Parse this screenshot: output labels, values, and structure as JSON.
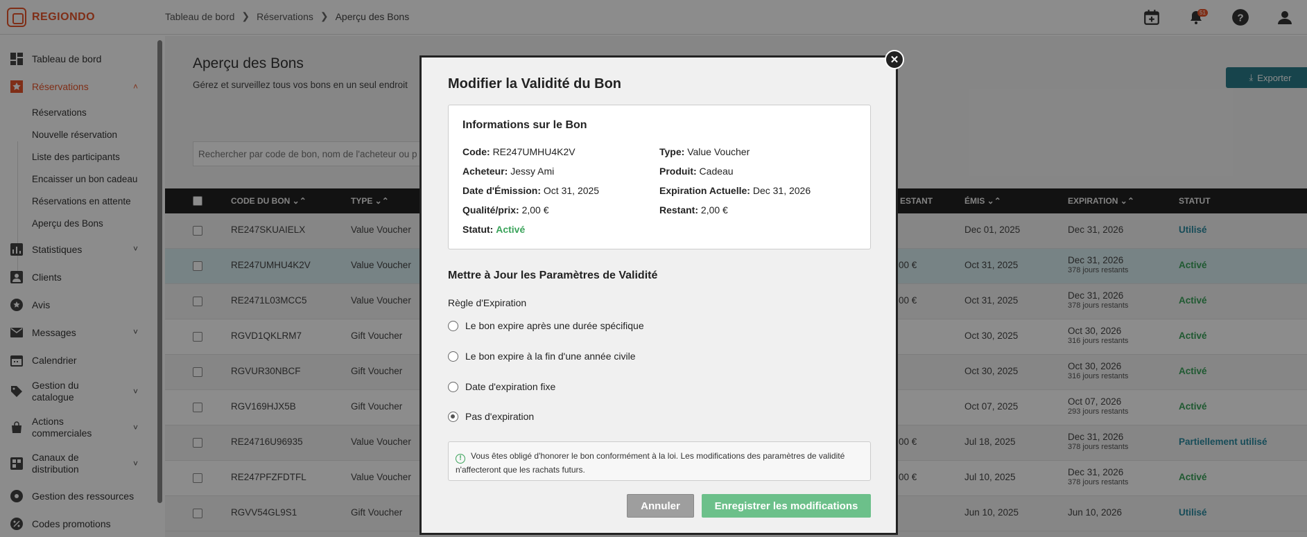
{
  "brand": {
    "name": "REGIONDO",
    "accent": "#e8552a"
  },
  "breadcrumb": [
    "Tableau de bord",
    "Réservations",
    "Aperçu des Bons"
  ],
  "topbar": {
    "notifications_count": "51"
  },
  "sidebar": {
    "items": [
      {
        "label": "Tableau de bord",
        "icon": "dashboard-icon"
      },
      {
        "label": "Réservations",
        "icon": "star-icon"
      },
      {
        "label": "Statistiques",
        "icon": "bar-chart-icon"
      },
      {
        "label": "Clients",
        "icon": "person-icon"
      },
      {
        "label": "Avis",
        "icon": "star-circle-icon"
      },
      {
        "label": "Messages",
        "icon": "mail-icon"
      },
      {
        "label": "Calendrier",
        "icon": "calendar-icon"
      },
      {
        "label": "Gestion du catalogue",
        "icon": "tag-icon"
      },
      {
        "label": "Actions commerciales",
        "icon": "shopping-bag-icon"
      },
      {
        "label": "Canaux de distribution",
        "icon": "grid-icon"
      },
      {
        "label": "Gestion des ressources",
        "icon": "resource-icon"
      },
      {
        "label": "Codes promotions",
        "icon": "percent-icon"
      }
    ],
    "sub_items": [
      "Réservations",
      "Nouvelle réservation",
      "Liste des participants",
      "Encaisser un bon cadeau",
      "Réservations en attente",
      "Aperçu des Bons"
    ]
  },
  "page": {
    "title": "Aperçu des Bons",
    "subtitle": "Gérez et surveillez tous vos bons en un seul endroit",
    "export_label": "Exporter",
    "search_placeholder": "Rechercher par code de bon, nom de l'acheteur ou p"
  },
  "table": {
    "headers": {
      "code": "CODE DU BON",
      "type": "TYPE",
      "restant": "ESTANT",
      "emis": "ÉMIS",
      "expiration": "EXPIRATION",
      "statut": "STATUT"
    },
    "rows": [
      {
        "code": "RE247SKUAIELX",
        "type": "Value Voucher",
        "restant": "",
        "emis": "Dec 01, 2025",
        "exp": "Dec 31, 2026",
        "exp_sub": "",
        "statut": "Utilisé"
      },
      {
        "code": "RE247UMHU4K2V",
        "type": "Value Voucher",
        "restant": "00 €",
        "emis": "Oct 31, 2025",
        "exp": "Dec 31, 2026",
        "exp_sub": "378 jours restants",
        "statut": "Activé"
      },
      {
        "code": "RE2471L03MCC5",
        "type": "Value Voucher",
        "restant": "00 €",
        "emis": "Oct 31, 2025",
        "exp": "Dec 31, 2026",
        "exp_sub": "378 jours restants",
        "statut": "Activé"
      },
      {
        "code": "RGVD1QKLRM7",
        "type": "Gift Voucher",
        "restant": "",
        "emis": "Oct 30, 2025",
        "exp": "Oct 30, 2026",
        "exp_sub": "316 jours restants",
        "statut": "Activé"
      },
      {
        "code": "RGVUR30NBCF",
        "type": "Gift Voucher",
        "restant": "",
        "emis": "Oct 30, 2025",
        "exp": "Oct 30, 2026",
        "exp_sub": "316 jours restants",
        "statut": "Activé"
      },
      {
        "code": "RGV169HJX5B",
        "type": "Gift Voucher",
        "restant": "",
        "emis": "Oct 07, 2025",
        "exp": "Oct 07, 2026",
        "exp_sub": "293 jours restants",
        "statut": "Activé"
      },
      {
        "code": "RE24716U96935",
        "type": "Value Voucher",
        "restant": "00 €",
        "emis": "Jul 18, 2025",
        "exp": "Dec 31, 2026",
        "exp_sub": "378 jours restants",
        "statut": "Partiellement utilisé"
      },
      {
        "code": "RE247PFZFDTFL",
        "type": "Value Voucher",
        "restant": "00 €",
        "emis": "Jul 10, 2025",
        "exp": "Dec 31, 2026",
        "exp_sub": "378 jours restants",
        "statut": "Activé"
      },
      {
        "code": "RGVV54GL9S1",
        "type": "Gift Voucher",
        "restant": "",
        "emis": "Jun 10, 2025",
        "exp": "Jun 10, 2026",
        "exp_sub": "",
        "statut": "Utilisé"
      }
    ]
  },
  "modal": {
    "title": "Modifier la Validité du Bon",
    "info_title": "Informations sur le Bon",
    "code_label": "Code:",
    "code_value": "RE247UMHU4K2V",
    "type_label": "Type:",
    "type_value": "Value Voucher",
    "buyer_label": "Acheteur:",
    "buyer_value": "Jessy Ami",
    "product_label": "Produit:",
    "product_value": "Cadeau",
    "issue_label": "Date d'Émission:",
    "issue_value": "Oct 31, 2025",
    "current_exp_label": "Expiration Actuelle:",
    "current_exp_value": "Dec 31, 2026",
    "price_label": "Qualité/prix:",
    "price_value": "2,00 €",
    "remaining_label": "Restant:",
    "remaining_value": "2,00 €",
    "status_label": "Statut:",
    "status_value": "Activé",
    "section_title": "Mettre à Jour les Paramètres de Validité",
    "rule_label": "Règle d'Expiration",
    "options": [
      "Le bon expire après une durée spécifique",
      "Le bon expire à la fin d'une année civile",
      "Date d'expiration fixe",
      "Pas d'expiration"
    ],
    "selected_option": "Pas d'expiration",
    "notice": "Vous êtes obligé d'honorer le bon conformément à la loi. Les modifications des paramètres de validité n'affecteront que les rachats futurs.",
    "cancel_label": "Annuler",
    "save_label": "Enregistrer les modifications"
  }
}
